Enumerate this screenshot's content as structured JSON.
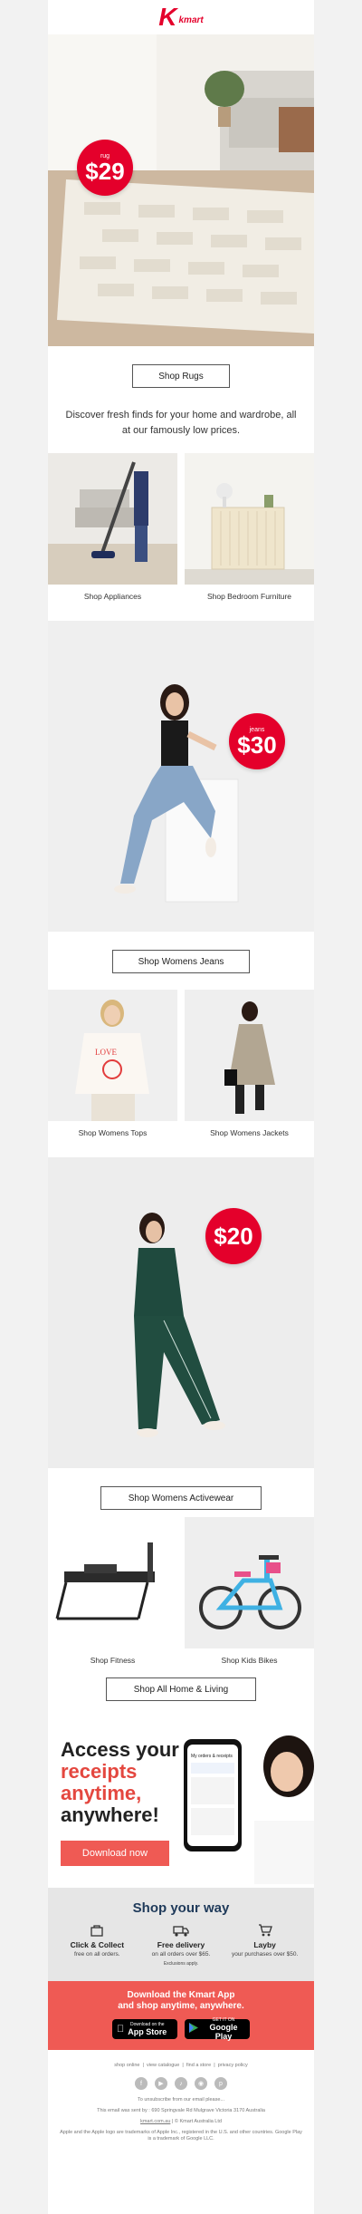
{
  "brand": {
    "logo_letter": "K",
    "logo_word": "kmart"
  },
  "hero": {
    "badge_label": "rug",
    "badge_price": "$29",
    "button": "Shop Rugs"
  },
  "intro": "Discover fresh finds for your home and wardrobe, all at our famously low prices.",
  "home_tiles": [
    {
      "label": "Shop Appliances"
    },
    {
      "label": "Shop Bedroom Furniture"
    }
  ],
  "jeans": {
    "badge_label": "jeans",
    "badge_price": "$30",
    "button": "Shop Womens Jeans"
  },
  "women_tiles": [
    {
      "label": "Shop Womens Tops"
    },
    {
      "label": "Shop Womens Jackets"
    }
  ],
  "active": {
    "badge_price": "$20",
    "button": "Shop Womens Activewear"
  },
  "misc_tiles": [
    {
      "label": "Shop Fitness"
    },
    {
      "label": "Shop Kids Bikes"
    }
  ],
  "all_button": "Shop All Home & Living",
  "app": {
    "line1": "Access your",
    "line2": "receipts",
    "line3": "anytime,",
    "line4": "anywhere!",
    "button": "Download now",
    "phone_header": "My orders & receipts"
  },
  "shop_way": {
    "title": "Shop your way",
    "items": [
      {
        "icon": "bag-icon",
        "title": "Click & Collect",
        "desc": "free on all orders."
      },
      {
        "icon": "truck-icon",
        "title": "Free delivery",
        "desc": "on all orders over $65.",
        "note": "Exclusions apply."
      },
      {
        "icon": "cart-icon",
        "title": "Layby",
        "desc": "your purchases over $50."
      }
    ]
  },
  "download": {
    "line1": "Download the Kmart App",
    "line2": "and shop anytime, anywhere.",
    "appstore_small": "Download on the",
    "appstore_big": "App Store",
    "play_small": "GET IT ON",
    "play_big": "Google Play"
  },
  "footer": {
    "links": [
      "shop online",
      "view catalogue",
      "find a store",
      "privacy policy"
    ],
    "social": [
      "facebook-icon",
      "youtube-icon",
      "tiktok-icon",
      "instagram-icon",
      "pinterest-icon"
    ],
    "unsubscribe": "To unsubscribe from our email please...",
    "sent_by": "This email was sent by : 690 Springvale Rd Mulgrave Victoria 3170 Australia",
    "site": "kmart.com.au",
    "copyright": "| © Kmart Australia Ltd",
    "legal": "Apple and the Apple logo are trademarks of Apple Inc., registered in the U.S. and other countries. Google Play is a trademark of Google LLC."
  }
}
